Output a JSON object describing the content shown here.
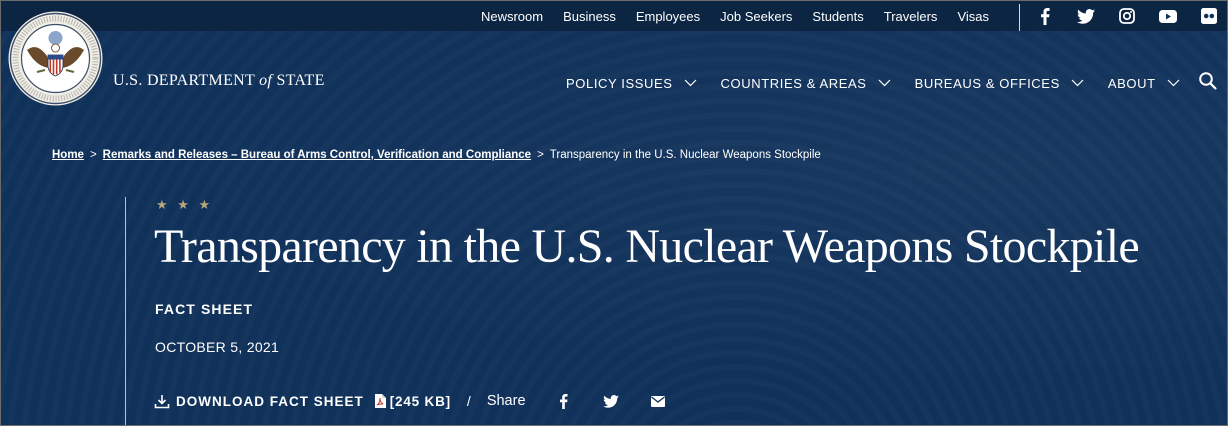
{
  "utility": {
    "links": [
      "Newsroom",
      "Business",
      "Employees",
      "Job Seekers",
      "Students",
      "Travelers",
      "Visas"
    ],
    "social": [
      "facebook-icon",
      "twitter-icon",
      "instagram-icon",
      "youtube-icon",
      "flickr-icon"
    ]
  },
  "brand": {
    "pre": "U.S. DEPARTMENT ",
    "of": "of",
    "post": " STATE"
  },
  "nav": {
    "items": [
      "POLICY ISSUES",
      "COUNTRIES & AREAS",
      "BUREAUS & OFFICES",
      "ABOUT"
    ]
  },
  "breadcrumb": {
    "home": "Home",
    "section": "Remarks and Releases – Bureau of Arms Control, Verification and Compliance",
    "current": "Transparency in the U.S. Nuclear Weapons Stockpile",
    "separator": ">"
  },
  "article": {
    "stars": "★ ★ ★",
    "title": "Transparency in the U.S. Nuclear Weapons Stockpile",
    "type": "FACT SHEET",
    "date": "OCTOBER 5, 2021",
    "download_label": "DOWNLOAD FACT SHEET",
    "file_size": "[245 KB]",
    "slash": "/",
    "share_label": "Share"
  },
  "colors": {
    "background": "#10315a",
    "utility_bar": "#0b2542",
    "star_gold": "#b7a57c"
  }
}
